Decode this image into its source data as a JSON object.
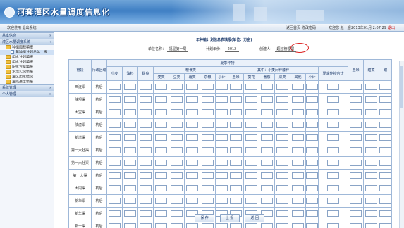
{
  "header": {
    "title": "河套灌区水量调度信息化",
    "left_text": "欢迎使用 退出系统",
    "right_items": [
      "返回首页",
      "修改密码"
    ],
    "user_text": "欢迎您 赵一超",
    "datetime": "2013年01月 2:07:29",
    "exit": "退出"
  },
  "sidebar": {
    "sections": [
      {
        "label": "基本信息"
      },
      {
        "label": "灌区水量调度系统"
      }
    ],
    "tree": [
      {
        "label": "种植面积填报",
        "level": 1,
        "icon": "folder"
      },
      {
        "label": "年种植计划总体上报",
        "level": 2,
        "icon": "doc",
        "active": true
      },
      {
        "label": "用水计划填报",
        "level": 1,
        "icon": "folder"
      },
      {
        "label": "用水计划填报",
        "level": 1,
        "icon": "folder"
      },
      {
        "label": "配水方案填报",
        "level": 1,
        "icon": "folder"
      },
      {
        "label": "水情实况填报",
        "level": 1,
        "icon": "folder"
      },
      {
        "label": "灌区用水情况",
        "level": 1,
        "icon": "folder"
      },
      {
        "label": "灌溉进度填报",
        "level": 1,
        "icon": "folder"
      }
    ],
    "bottom_sections": [
      {
        "label": "系统管理"
      },
      {
        "label": "个人管理"
      }
    ]
  },
  "form": {
    "title": "年种植计划信息表填报(单位：万亩)",
    "unit_label": "单位名称：",
    "unit_value": "福星第一局",
    "year_label": "计划年份：",
    "year_value": "2012",
    "creator_label": "创建人：",
    "creator_value": "超越管理员"
  },
  "table": {
    "col_region": "管段",
    "col_admin": "行政区域",
    "group_summer": "夏季作物",
    "group_grain": "粮食类",
    "group_mid": "其中：小麦间种套种",
    "col_summer_total": "夏季作物合计",
    "first_cols": [
      "小麦",
      "油料",
      "甜菜"
    ],
    "grain_cols": [
      "麦类",
      "豆类",
      "薯类",
      "杂粮",
      "小计"
    ],
    "mid_cols": [
      "玉米",
      "葵花",
      "番茄",
      "瓜类",
      "其他",
      "小计"
    ],
    "tail_cols": [
      "玉米",
      "甜菜",
      "甜"
    ],
    "rows": [
      {
        "name": "西连渠",
        "admin": "杭后"
      },
      {
        "name": "陕坝渠",
        "admin": "杭后"
      },
      {
        "name": "大宝渠",
        "admin": "杭后"
      },
      {
        "name": "陕虎渠",
        "admin": "杭后"
      },
      {
        "name": "新增渠",
        "admin": "杭后"
      },
      {
        "name": "第一六社渠",
        "admin": "杭后"
      },
      {
        "name": "第一六社渠",
        "admin": "杭后"
      },
      {
        "name": "第一大渠",
        "admin": "杭后"
      },
      {
        "name": "大同渠",
        "admin": "杭后"
      },
      {
        "name": "新华渠",
        "admin": "杭后"
      },
      {
        "name": "新华渠",
        "admin": "杭后"
      },
      {
        "name": "新一渠",
        "admin": "杭后"
      }
    ]
  },
  "buttons": {
    "save": "保 存",
    "submit": "上 报",
    "back": "返 回"
  },
  "colors": {
    "accent": "#3f7fc4",
    "circle": "#dd2222"
  }
}
